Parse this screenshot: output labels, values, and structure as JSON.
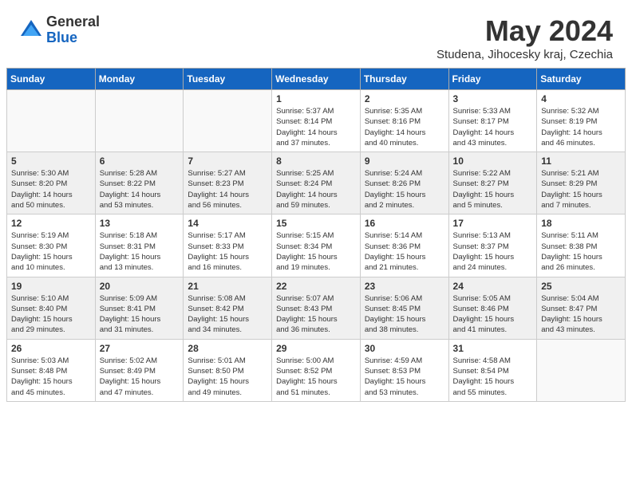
{
  "logo": {
    "general": "General",
    "blue": "Blue"
  },
  "title": "May 2024",
  "location": "Studena, Jihocesky kraj, Czechia",
  "days_of_week": [
    "Sunday",
    "Monday",
    "Tuesday",
    "Wednesday",
    "Thursday",
    "Friday",
    "Saturday"
  ],
  "weeks": [
    [
      {
        "day": "",
        "info": ""
      },
      {
        "day": "",
        "info": ""
      },
      {
        "day": "",
        "info": ""
      },
      {
        "day": "1",
        "info": "Sunrise: 5:37 AM\nSunset: 8:14 PM\nDaylight: 14 hours\nand 37 minutes."
      },
      {
        "day": "2",
        "info": "Sunrise: 5:35 AM\nSunset: 8:16 PM\nDaylight: 14 hours\nand 40 minutes."
      },
      {
        "day": "3",
        "info": "Sunrise: 5:33 AM\nSunset: 8:17 PM\nDaylight: 14 hours\nand 43 minutes."
      },
      {
        "day": "4",
        "info": "Sunrise: 5:32 AM\nSunset: 8:19 PM\nDaylight: 14 hours\nand 46 minutes."
      }
    ],
    [
      {
        "day": "5",
        "info": "Sunrise: 5:30 AM\nSunset: 8:20 PM\nDaylight: 14 hours\nand 50 minutes."
      },
      {
        "day": "6",
        "info": "Sunrise: 5:28 AM\nSunset: 8:22 PM\nDaylight: 14 hours\nand 53 minutes."
      },
      {
        "day": "7",
        "info": "Sunrise: 5:27 AM\nSunset: 8:23 PM\nDaylight: 14 hours\nand 56 minutes."
      },
      {
        "day": "8",
        "info": "Sunrise: 5:25 AM\nSunset: 8:24 PM\nDaylight: 14 hours\nand 59 minutes."
      },
      {
        "day": "9",
        "info": "Sunrise: 5:24 AM\nSunset: 8:26 PM\nDaylight: 15 hours\nand 2 minutes."
      },
      {
        "day": "10",
        "info": "Sunrise: 5:22 AM\nSunset: 8:27 PM\nDaylight: 15 hours\nand 5 minutes."
      },
      {
        "day": "11",
        "info": "Sunrise: 5:21 AM\nSunset: 8:29 PM\nDaylight: 15 hours\nand 7 minutes."
      }
    ],
    [
      {
        "day": "12",
        "info": "Sunrise: 5:19 AM\nSunset: 8:30 PM\nDaylight: 15 hours\nand 10 minutes."
      },
      {
        "day": "13",
        "info": "Sunrise: 5:18 AM\nSunset: 8:31 PM\nDaylight: 15 hours\nand 13 minutes."
      },
      {
        "day": "14",
        "info": "Sunrise: 5:17 AM\nSunset: 8:33 PM\nDaylight: 15 hours\nand 16 minutes."
      },
      {
        "day": "15",
        "info": "Sunrise: 5:15 AM\nSunset: 8:34 PM\nDaylight: 15 hours\nand 19 minutes."
      },
      {
        "day": "16",
        "info": "Sunrise: 5:14 AM\nSunset: 8:36 PM\nDaylight: 15 hours\nand 21 minutes."
      },
      {
        "day": "17",
        "info": "Sunrise: 5:13 AM\nSunset: 8:37 PM\nDaylight: 15 hours\nand 24 minutes."
      },
      {
        "day": "18",
        "info": "Sunrise: 5:11 AM\nSunset: 8:38 PM\nDaylight: 15 hours\nand 26 minutes."
      }
    ],
    [
      {
        "day": "19",
        "info": "Sunrise: 5:10 AM\nSunset: 8:40 PM\nDaylight: 15 hours\nand 29 minutes."
      },
      {
        "day": "20",
        "info": "Sunrise: 5:09 AM\nSunset: 8:41 PM\nDaylight: 15 hours\nand 31 minutes."
      },
      {
        "day": "21",
        "info": "Sunrise: 5:08 AM\nSunset: 8:42 PM\nDaylight: 15 hours\nand 34 minutes."
      },
      {
        "day": "22",
        "info": "Sunrise: 5:07 AM\nSunset: 8:43 PM\nDaylight: 15 hours\nand 36 minutes."
      },
      {
        "day": "23",
        "info": "Sunrise: 5:06 AM\nSunset: 8:45 PM\nDaylight: 15 hours\nand 38 minutes."
      },
      {
        "day": "24",
        "info": "Sunrise: 5:05 AM\nSunset: 8:46 PM\nDaylight: 15 hours\nand 41 minutes."
      },
      {
        "day": "25",
        "info": "Sunrise: 5:04 AM\nSunset: 8:47 PM\nDaylight: 15 hours\nand 43 minutes."
      }
    ],
    [
      {
        "day": "26",
        "info": "Sunrise: 5:03 AM\nSunset: 8:48 PM\nDaylight: 15 hours\nand 45 minutes."
      },
      {
        "day": "27",
        "info": "Sunrise: 5:02 AM\nSunset: 8:49 PM\nDaylight: 15 hours\nand 47 minutes."
      },
      {
        "day": "28",
        "info": "Sunrise: 5:01 AM\nSunset: 8:50 PM\nDaylight: 15 hours\nand 49 minutes."
      },
      {
        "day": "29",
        "info": "Sunrise: 5:00 AM\nSunset: 8:52 PM\nDaylight: 15 hours\nand 51 minutes."
      },
      {
        "day": "30",
        "info": "Sunrise: 4:59 AM\nSunset: 8:53 PM\nDaylight: 15 hours\nand 53 minutes."
      },
      {
        "day": "31",
        "info": "Sunrise: 4:58 AM\nSunset: 8:54 PM\nDaylight: 15 hours\nand 55 minutes."
      },
      {
        "day": "",
        "info": ""
      }
    ]
  ]
}
